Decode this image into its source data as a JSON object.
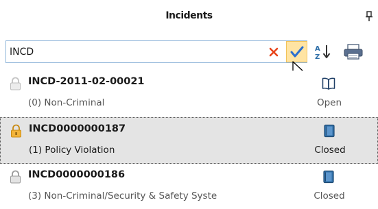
{
  "header": {
    "title": "Incidents",
    "pin_icon": "pin-icon"
  },
  "search": {
    "value": "INCD",
    "clear_icon": "close-x-icon",
    "apply_icon": "checkmark-icon"
  },
  "toolbar": {
    "sort_icon": "sort-az-icon",
    "print_icon": "printer-icon"
  },
  "colors": {
    "apply_bg": "#ffe4a3",
    "clear_x": "#e8441a",
    "check": "#2b6fcf",
    "selected_row": "#e4e4e4",
    "lock_gold": "#e8a317",
    "closed_book": "#2f6fa8"
  },
  "incidents": [
    {
      "id": "INCD-2011-02-00021",
      "description": "(0) Non-Criminal",
      "status": "Open",
      "lock_icon": "lock-open-gray-icon",
      "status_icon": "open-book-icon",
      "selected": false
    },
    {
      "id": "INCD0000000187",
      "description": "(1) Policy Violation",
      "status": "Closed",
      "lock_icon": "lock-gold-icon",
      "status_icon": "closed-book-icon",
      "selected": true
    },
    {
      "id": "INCD0000000186",
      "description": "(3) Non-Criminal/Security & Safety Syste",
      "status": "Closed",
      "lock_icon": "lock-gray-icon",
      "status_icon": "closed-book-icon",
      "selected": false
    }
  ]
}
